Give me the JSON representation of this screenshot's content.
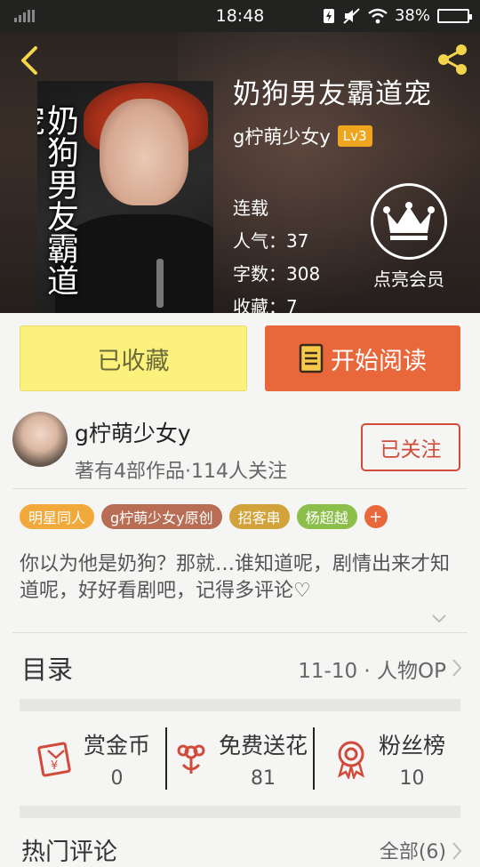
{
  "status_bar": {
    "time": "18:48",
    "battery": "38%"
  },
  "book": {
    "title": "奶狗男友霸道宠",
    "cover_title": "奶狗男友霸道宠",
    "author": "g柠萌少女y",
    "level": "Lv3",
    "status": "连载",
    "popularity": "人气：37",
    "word_count": "字数：308",
    "favorites": "收藏：7"
  },
  "vip": {
    "label": "点亮会员"
  },
  "buttons": {
    "favorite": "已收藏",
    "read": "开始阅读"
  },
  "author_card": {
    "name": "g柠萌少女y",
    "stats": "著有4部作品·114人关注",
    "follow": "已关注"
  },
  "tags": [
    {
      "label": "明星同人",
      "color": "#f2a93b"
    },
    {
      "label": "g柠萌少女y原创",
      "color": "#b86d55"
    },
    {
      "label": "招客串",
      "color": "#d2a23b"
    },
    {
      "label": "杨超越",
      "color": "#8bbf4a"
    },
    {
      "label": "+",
      "color": "#e8683b"
    }
  ],
  "description": "你以为他是奶狗？那就…谁知道呢，剧情出来才知道呢，好好看剧吧，记得多评论♡",
  "toc": {
    "label": "目录",
    "latest": "11-10 · 人物OP"
  },
  "actions": [
    {
      "name": "赏金币",
      "value": "0"
    },
    {
      "name": "免费送花",
      "value": "81"
    },
    {
      "name": "粉丝榜",
      "value": "10"
    }
  ],
  "comments": {
    "label": "热门评论",
    "all": "全部(6)"
  },
  "colors": {
    "accent": "#e8683b",
    "favorite_bg": "#fbf17c",
    "follow": "#d24a3b",
    "icon_red": "#d24a3b"
  }
}
